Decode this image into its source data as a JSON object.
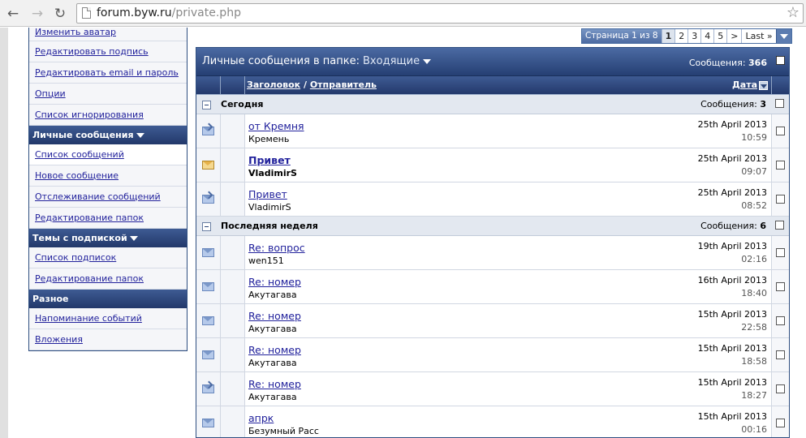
{
  "browser": {
    "url_host": "forum.byw.ru",
    "url_path": "/private.php"
  },
  "sidebar": {
    "top_links": [
      {
        "label": "Изменить аватар"
      },
      {
        "label": "Редактировать подпись"
      },
      {
        "label": "Редактировать email и пароль"
      },
      {
        "label": "Опции"
      },
      {
        "label": "Список игнорирования"
      }
    ],
    "pm_header": "Личные сообщения",
    "pm_links": [
      {
        "label": "Список сообщений"
      },
      {
        "label": "Новое сообщение"
      },
      {
        "label": "Отслеживание сообщений"
      },
      {
        "label": "Редактирование папок"
      }
    ],
    "subs_header": "Темы с подпиской",
    "subs_links": [
      {
        "label": "Список подписок"
      },
      {
        "label": "Редактирование папок"
      }
    ],
    "misc_header": "Разное",
    "misc_links": [
      {
        "label": "Напоминание событий"
      },
      {
        "label": "Вложения"
      }
    ]
  },
  "pager": {
    "label": "Страница 1 из 8",
    "pages": [
      "1",
      "2",
      "3",
      "4",
      "5"
    ],
    "next": ">",
    "last": "Last »"
  },
  "panel": {
    "title": "Личные сообщения в папке:",
    "folder": "Входящие",
    "count_label": "Сообщения:",
    "count": "366",
    "col_title": "Заголовок",
    "col_sep": " / ",
    "col_sender": "Отправитель",
    "col_date": "Дата"
  },
  "groups": [
    {
      "name": "Сегодня",
      "count_label": "Сообщения:",
      "count": "3",
      "messages": [
        {
          "title": "от Кремня",
          "sender": "Кремень",
          "date": "25th April 2013",
          "time": "10:59",
          "icon": "forwarded-envelope-icon",
          "unread": false
        },
        {
          "title": "Привет",
          "sender": "VladimirS",
          "date": "25th April 2013",
          "time": "09:07",
          "icon": "open-envelope-icon",
          "unread": true
        },
        {
          "title": "Привет",
          "sender": "VladimirS",
          "date": "25th April 2013",
          "time": "08:52",
          "icon": "forwarded-envelope-icon",
          "unread": false
        }
      ]
    },
    {
      "name": "Последняя неделя",
      "count_label": "Сообщения:",
      "count": "6",
      "messages": [
        {
          "title": "Re: вопрос",
          "sender": "wen151",
          "date": "19th April 2013",
          "time": "02:16",
          "icon": "envelope-icon",
          "unread": false
        },
        {
          "title": "Re: номер",
          "sender": "Акутагава",
          "date": "16th April 2013",
          "time": "18:40",
          "icon": "envelope-icon",
          "unread": false
        },
        {
          "title": "Re: номер",
          "sender": "Акутагава",
          "date": "15th April 2013",
          "time": "22:58",
          "icon": "envelope-icon",
          "unread": false
        },
        {
          "title": "Re: номер",
          "sender": "Акутагава",
          "date": "15th April 2013",
          "time": "18:58",
          "icon": "envelope-icon",
          "unread": false
        },
        {
          "title": "Re: номер",
          "sender": "Акутагава",
          "date": "15th April 2013",
          "time": "18:27",
          "icon": "forwarded-envelope-icon",
          "unread": false
        },
        {
          "title": "апрк",
          "sender": "Безумный Расс",
          "date": "15th April 2013",
          "time": "00:16",
          "icon": "envelope-icon",
          "unread": false
        }
      ]
    }
  ]
}
